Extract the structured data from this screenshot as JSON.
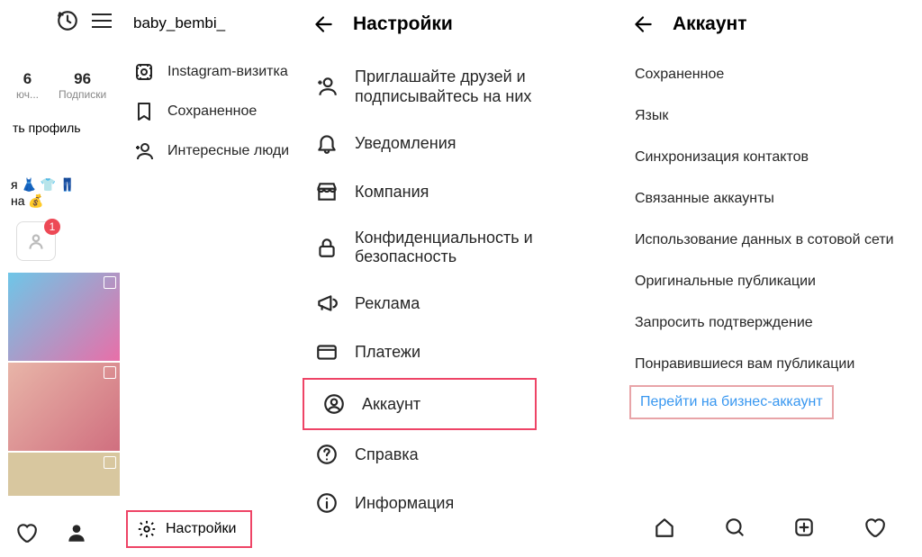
{
  "col1": {
    "username": "baby_bembi_",
    "stat_count": "6",
    "stat_subs": "96",
    "stat_count_lbl": "юч...",
    "stat_subs_lbl": "Подписки",
    "edit_profile": "ть профиль",
    "emoji_line1": "я 👗 👕 👖",
    "emoji_line2": "на 💰",
    "story_badge": "1",
    "drawer": {
      "nametag": "Instagram-визитка",
      "saved": "Сохраненное",
      "discover": "Интересные люди"
    },
    "settings_label": "Настройки"
  },
  "col2": {
    "title": "Настройки",
    "invite": "Приглашайте друзей и подписывайтесь на них",
    "notifications": "Уведомления",
    "business": "Компания",
    "privacy": "Конфиденциальность и безопасность",
    "ads": "Реклама",
    "payments": "Платежи",
    "account": "Аккаунт",
    "help": "Справка",
    "about": "Информация"
  },
  "col3": {
    "title": "Аккаунт",
    "saved": "Сохраненное",
    "language": "Язык",
    "contacts": "Синхронизация контактов",
    "linked": "Связанные аккаунты",
    "cellular": "Использование данных в сотовой сети",
    "original": "Оригинальные публикации",
    "verify": "Запросить подтверждение",
    "liked": "Понравившиеся вам публикации",
    "switch": "Перейти на бизнес-аккаунт"
  }
}
